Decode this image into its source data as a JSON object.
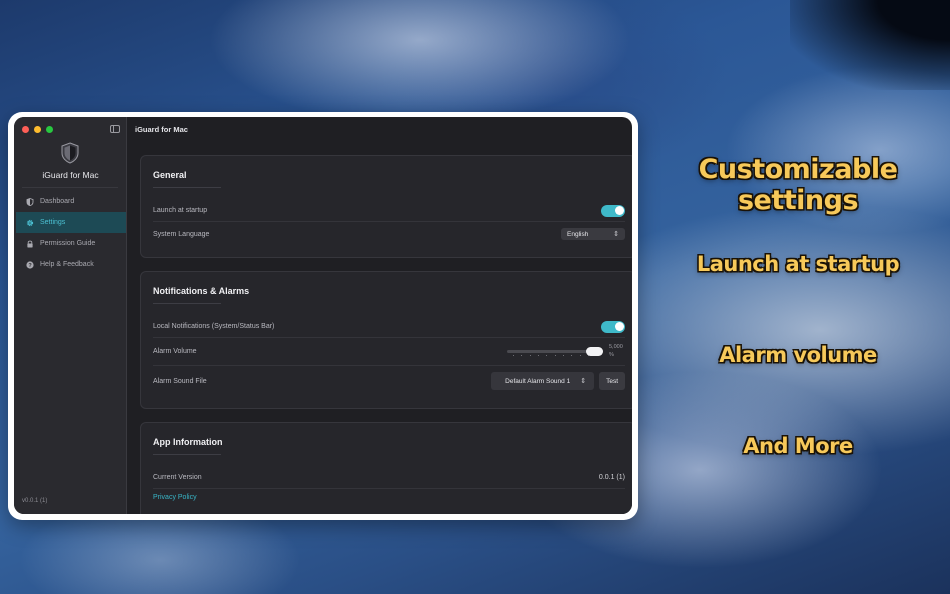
{
  "captions": [
    "Customizable settings",
    "Launch at startup",
    "Alarm volume",
    "And More"
  ],
  "window": {
    "title": "iGuard for Mac"
  },
  "sidebar": {
    "app_name": "iGuard for Mac",
    "items": [
      {
        "label": "Dashboard",
        "icon": "shield-icon",
        "active": false
      },
      {
        "label": "Settings",
        "icon": "gear-icon",
        "active": true
      },
      {
        "label": "Permission Guide",
        "icon": "lock-icon",
        "active": false
      },
      {
        "label": "Help & Feedback",
        "icon": "question-icon",
        "active": false
      }
    ],
    "version": "v0.0.1 (1)"
  },
  "general": {
    "title": "General",
    "launch_label": "Launch at startup",
    "launch_enabled": true,
    "language_label": "System Language",
    "language_value": "English"
  },
  "notifications": {
    "title": "Notifications & Alarms",
    "local_label": "Local Notifications (System/Status Bar)",
    "local_enabled": true,
    "volume_label": "Alarm Volume",
    "volume_value": "5,000",
    "volume_unit": "%",
    "volume_level": 1.0,
    "sound_label": "Alarm Sound File",
    "sound_value": "Default Alarm Sound 1",
    "test_label": "Test"
  },
  "app_info": {
    "title": "App Information",
    "version_label": "Current Version",
    "version_value": "0.0.1 (1)",
    "privacy_label": "Privacy Policy"
  },
  "colors": {
    "accent": "#3fb9c9",
    "caption": "#f7c95a",
    "window_bg": "#1f1f23"
  }
}
